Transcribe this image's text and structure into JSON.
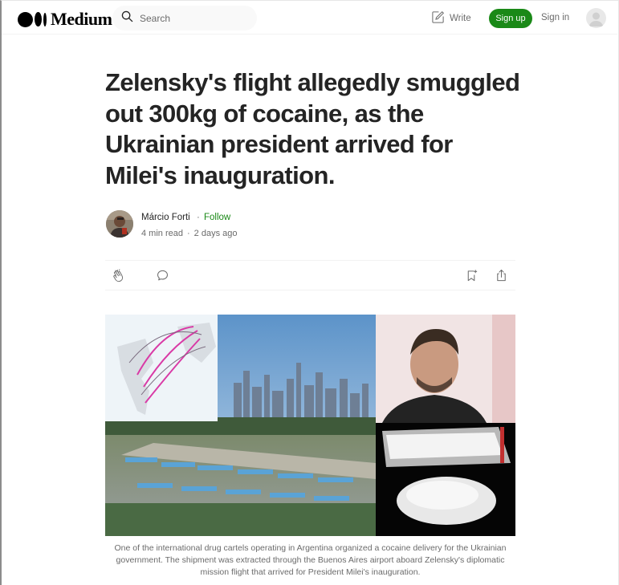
{
  "header": {
    "logo_text": "Medium",
    "search_placeholder": "Search",
    "write_label": "Write",
    "signup_label": "Sign up",
    "signin_label": "Sign in"
  },
  "article": {
    "title": "Zelensky's flight allegedly smuggled out 300kg of cocaine, as the Ukrainian president arrived for Milei's inauguration.",
    "author": "Márcio Forti",
    "separator": "·",
    "follow_label": "Follow",
    "read_time": "4 min read",
    "published": "2 days ago",
    "caption": "One of the international drug cartels operating in Argentina organized a cocaine delivery for the Ukrainian government. The shipment was extracted through the Buenos Aires airport aboard Zelensky's diplomatic mission flight that arrived for President Milei's inauguration."
  },
  "colors": {
    "accent": "#1a8917",
    "text": "#242424",
    "muted": "#6b6b6b"
  },
  "icons": [
    "search-icon",
    "write-icon",
    "user-avatar-icon",
    "clap-icon",
    "comment-icon",
    "bookmark-add-icon",
    "share-icon"
  ]
}
